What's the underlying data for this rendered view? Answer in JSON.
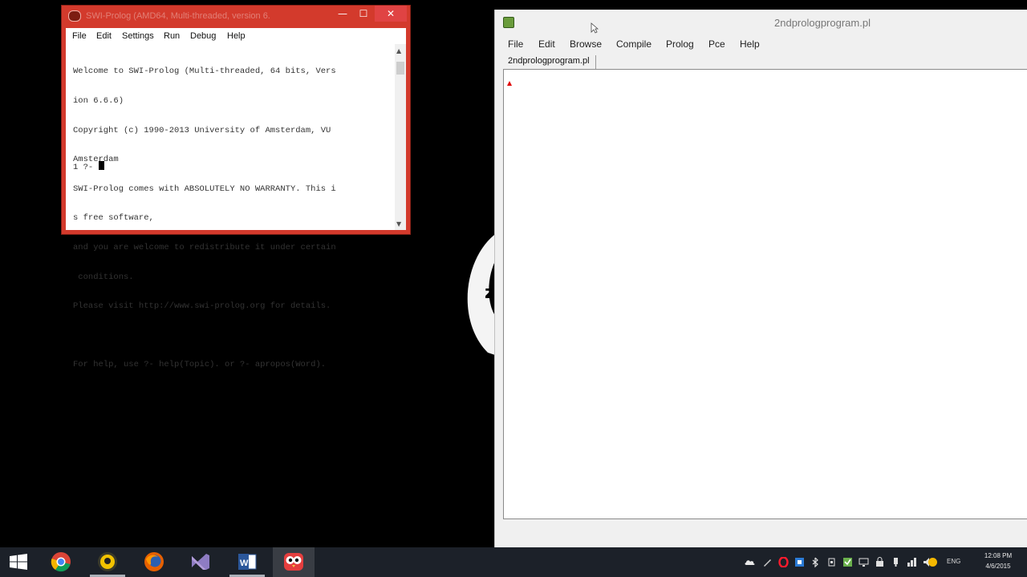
{
  "console": {
    "title": "SWI-Prolog (AMD64, Multi-threaded, version 6.",
    "controls": {
      "minimize": "—",
      "maximize": "☐",
      "close": "✕"
    },
    "menu": [
      "File",
      "Edit",
      "Settings",
      "Run",
      "Debug",
      "Help"
    ],
    "lines": [
      "Welcome to SWI-Prolog (Multi-threaded, 64 bits, Vers",
      "ion 6.6.6)",
      "Copyright (c) 1990-2013 University of Amsterdam, VU",
      "Amsterdam",
      "SWI-Prolog comes with ABSOLUTELY NO WARRANTY. This i",
      "s free software,",
      "and you are welcome to redistribute it under certain",
      " conditions.",
      "Please visit http://www.swi-prolog.org for details.",
      "",
      "For help, use ?- help(Topic). or ?- apropos(Word)."
    ],
    "prompt": "1 ?- "
  },
  "editor": {
    "title": "2ndprologprogram.pl",
    "menu": [
      "File",
      "Edit",
      "Browse",
      "Compile",
      "Prolog",
      "Pce",
      "Help"
    ],
    "tab": "2ndprologprogram.pl"
  },
  "taskbar": {
    "apps": [
      {
        "icon": "chrome-icon"
      },
      {
        "icon": "vlc-player-icon"
      },
      {
        "icon": "firefox-icon"
      },
      {
        "icon": "visual-studio-icon"
      },
      {
        "icon": "word-icon"
      },
      {
        "icon": "swi-prolog-icon"
      }
    ],
    "language": "ENG",
    "time": "12:08 PM",
    "date": "4/6/2015"
  },
  "colors": {
    "console_frame": "#d33a2c",
    "close_button": "#e04343",
    "taskbar": "#1c2129",
    "editor_frame": "#f0f0f0"
  }
}
